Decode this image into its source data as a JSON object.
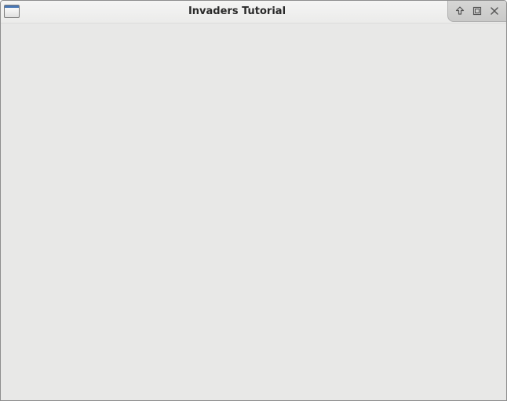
{
  "window": {
    "title": "Invaders Tutorial"
  },
  "icons": {
    "app": "window-app-icon",
    "shade": "arrow-up-icon",
    "maximize": "maximize-icon",
    "close": "close-icon"
  },
  "colors": {
    "client_background": "#e8e8e7",
    "titlebar": "#efefee",
    "app_icon_accent": "#4a78b5"
  }
}
